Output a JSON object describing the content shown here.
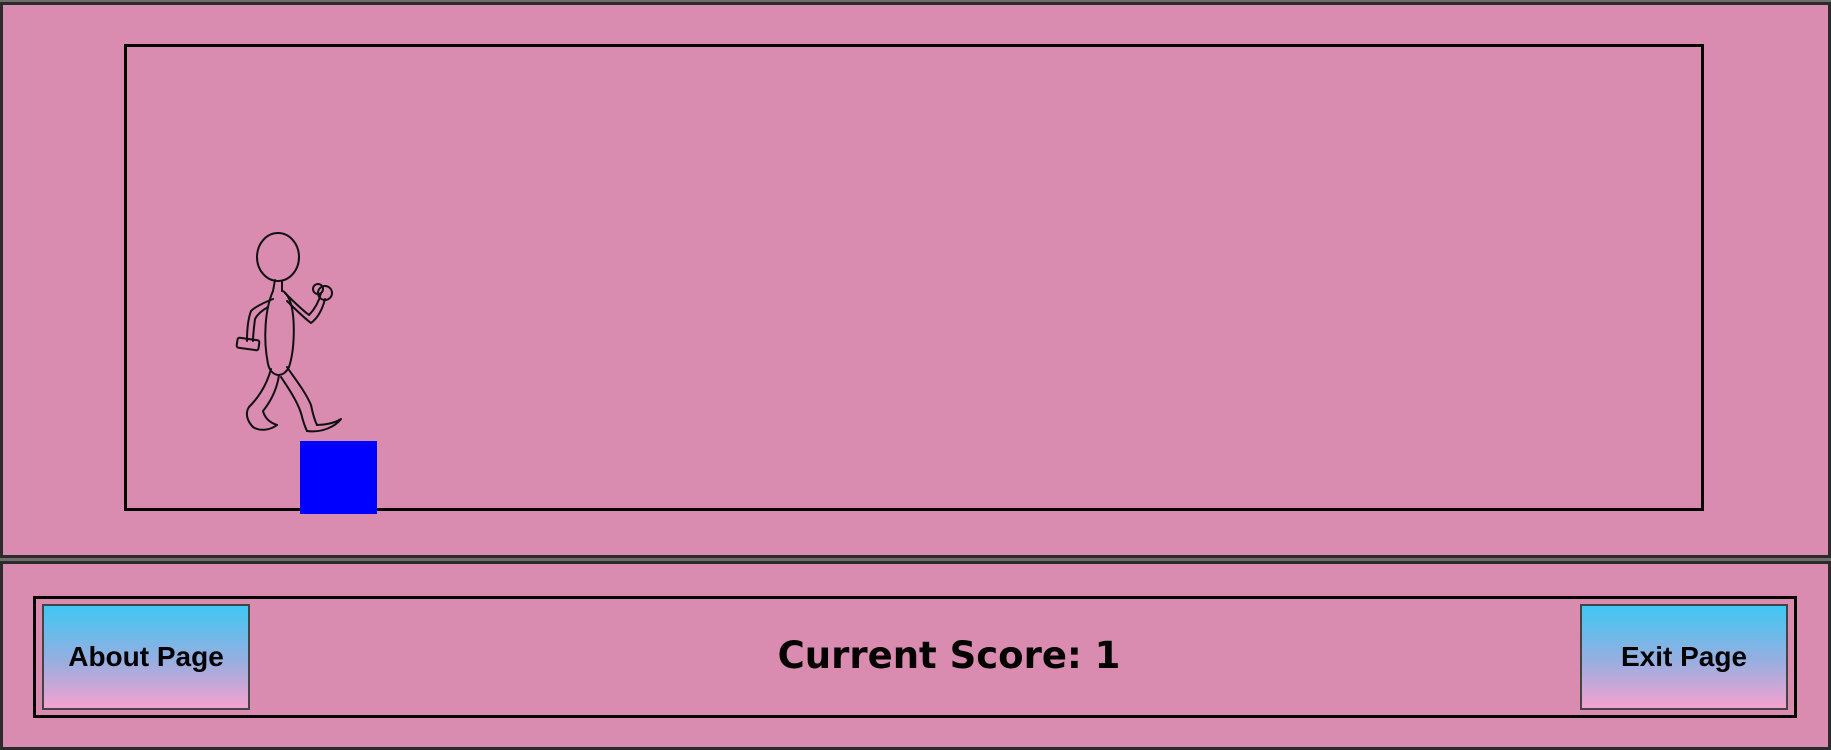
{
  "game": {
    "background_color": "#d98bb0",
    "character": {
      "icon": "stick-figure-running-icon"
    },
    "obstacle": {
      "color": "#0000ff"
    }
  },
  "controls": {
    "about_label": "About Page",
    "exit_label": "Exit Page",
    "score_label": "Current Score:",
    "score_value": "1",
    "button_gradient": [
      "#3ec7f2",
      "#9aaee0",
      "#f5a1d0"
    ]
  }
}
